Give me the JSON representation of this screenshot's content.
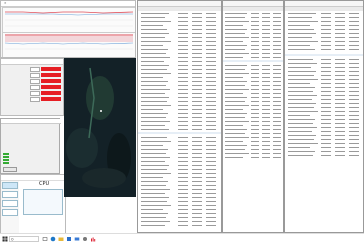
{
  "graph_window": {
    "title": "",
    "close": "✕"
  },
  "tool_window": {
    "title": "",
    "rows": [
      "",
      "",
      "",
      "",
      "",
      ""
    ]
  },
  "task_manager": {
    "cpu_label": "CPU",
    "stats": [
      "",
      ""
    ]
  },
  "hw_windows": {
    "main_title": "",
    "sensors_title": ""
  },
  "taskbar": {
    "search_placeholder": "",
    "time": "",
    "date": ""
  },
  "colors": {
    "accent_red": "#e61e24",
    "status_green": "#3a3",
    "graph_red": "#e0505a",
    "graph_blue": "#6aa0d8",
    "selection_blue": "#cde6f7"
  },
  "icons": [
    "windows-start-icon",
    "search-icon",
    "task-view-icon",
    "edge-icon",
    "folder-icon",
    "store-icon",
    "mail-icon",
    "gear-icon",
    "chart-icon",
    "close-icon"
  ]
}
